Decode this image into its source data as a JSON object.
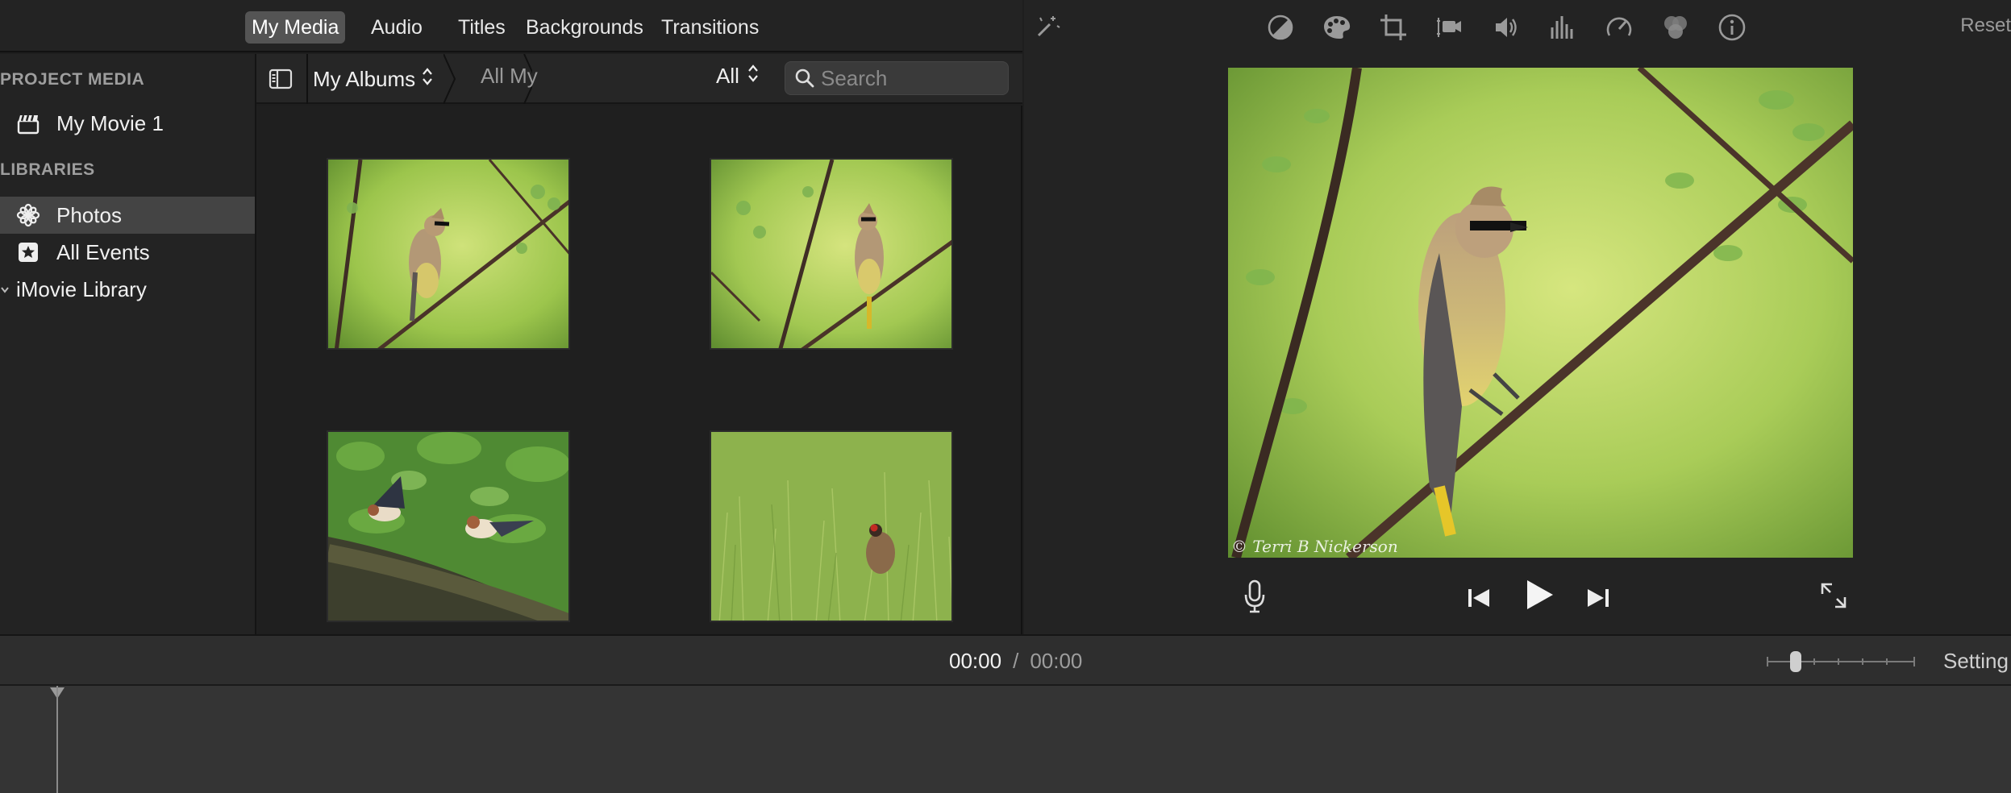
{
  "browser_tabs": [
    {
      "label": "My Media",
      "active": true
    },
    {
      "label": "Audio",
      "active": false
    },
    {
      "label": "Titles",
      "active": false
    },
    {
      "label": "Backgrounds",
      "active": false
    },
    {
      "label": "Transitions",
      "active": false
    }
  ],
  "sidebar": {
    "project_heading": "PROJECT MEDIA",
    "project_item": {
      "label": "My Movie 1",
      "icon": "clapperboard-icon"
    },
    "libraries_heading": "LIBRARIES",
    "library_items": [
      {
        "label": "Photos",
        "icon": "photos-icon",
        "selected": true
      },
      {
        "label": "All Events",
        "icon": "star-icon",
        "selected": false
      },
      {
        "label": "iMovie Library",
        "icon": "chevron-down-icon",
        "selected": false
      }
    ]
  },
  "browser_toolbar": {
    "albums_label": "My Albums",
    "breadcrumb": "All My",
    "filter_label": "All",
    "search_placeholder": "Search"
  },
  "media_grid": {
    "thumbnails": [
      {
        "subject": "cedar waxwing on branch"
      },
      {
        "subject": "cedar waxwing on branch"
      },
      {
        "subject": "two barn swallows on log"
      },
      {
        "subject": "pheasant in grass"
      }
    ]
  },
  "viewer": {
    "toolbar_icons": [
      "magic-wand-icon",
      "color-balance-icon",
      "color-correction-icon",
      "crop-icon",
      "stabilization-icon",
      "volume-icon",
      "noise-reduction-icon",
      "speed-icon",
      "clip-filter-icon",
      "info-icon"
    ],
    "reset_label": "Reset",
    "watermark": "© Terri B Nickerson",
    "controls": [
      "microphone-icon",
      "skip-back-icon",
      "play-icon",
      "skip-forward-icon",
      "fullscreen-icon"
    ]
  },
  "timeline": {
    "current_time": "00:00",
    "separator": "/",
    "total_time": "00:00",
    "settings_label": "Setting"
  },
  "colors": {
    "background": "#1e1e1e",
    "panel": "#232323",
    "selected": "#444444",
    "active_tab": "#545454",
    "timeline": "#343434"
  }
}
